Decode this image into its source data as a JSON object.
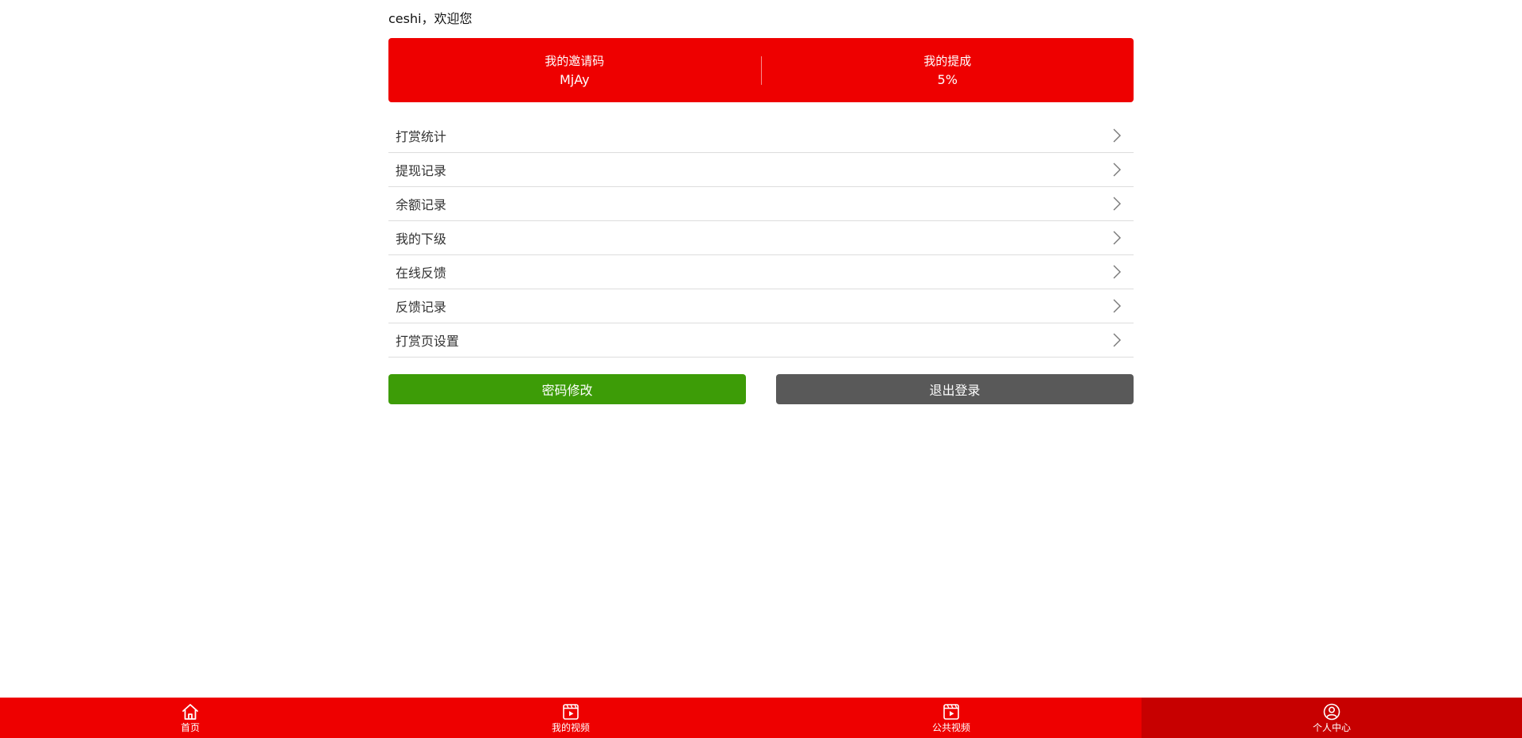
{
  "header": {
    "welcome": "ceshi，欢迎您"
  },
  "stats": {
    "invite_label": "我的邀请码",
    "invite_value": "MjAy",
    "commission_label": "我的提成",
    "commission_value": "5%"
  },
  "menu": {
    "items": [
      {
        "label": "打赏统计",
        "icon": "chevron-right-icon"
      },
      {
        "label": "提现记录",
        "icon": "chevron-right-icon"
      },
      {
        "label": "余额记录",
        "icon": "chevron-right-icon"
      },
      {
        "label": "我的下级",
        "icon": "chevron-right-icon"
      },
      {
        "label": "在线反馈",
        "icon": "chevron-right-icon"
      },
      {
        "label": "反馈记录",
        "icon": "chevron-right-icon"
      },
      {
        "label": "打赏页设置",
        "icon": "chevron-right-icon"
      }
    ]
  },
  "actions": {
    "change_password": "密码修改",
    "logout": "退出登录"
  },
  "tabbar": {
    "items": [
      {
        "label": "首页",
        "icon": "home-icon",
        "active": false
      },
      {
        "label": "我的视频",
        "icon": "video-icon",
        "active": false
      },
      {
        "label": "公共视频",
        "icon": "video-icon",
        "active": false
      },
      {
        "label": "个人中心",
        "icon": "user-icon",
        "active": true
      }
    ]
  },
  "colors": {
    "brand_red": "#ee0000",
    "active_tab": "#c70000",
    "green_button": "#3d9c07",
    "gray_button": "#595959"
  }
}
